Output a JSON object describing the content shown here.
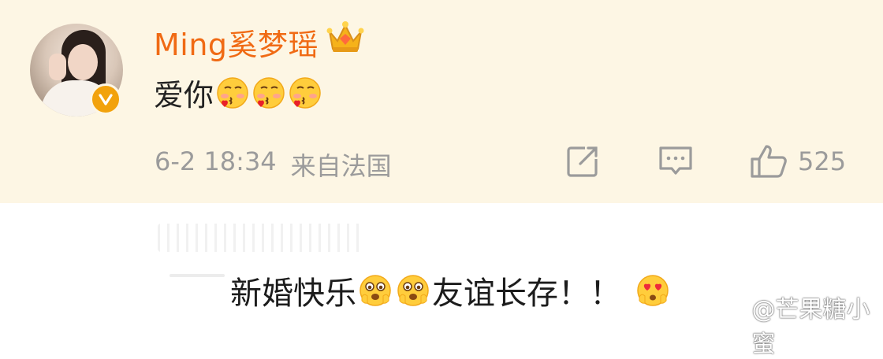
{
  "comment": {
    "username": "Ming奚梦瑶",
    "text": "爱你",
    "emoji_count": 3,
    "timestamp": "6-2 18:34",
    "location": "来自法国",
    "like_count": "525",
    "username_color": "#f06a14",
    "background_color": "#fdf6e4"
  },
  "reply": {
    "part1": "新婚快乐",
    "part2": "友谊长存！！"
  },
  "watermark": {
    "text": "@芒果糖小蜜"
  },
  "icons": {
    "crown": "crown-icon",
    "verified": "verified-v-icon",
    "repost": "repost-icon",
    "comment": "comment-icon",
    "like": "thumbs-up-icon"
  }
}
